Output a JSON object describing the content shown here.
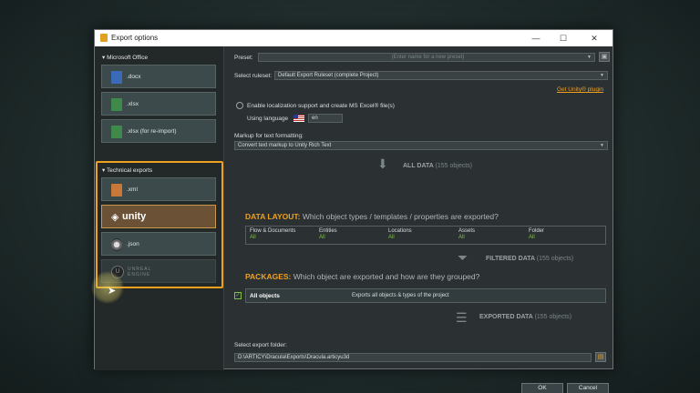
{
  "window": {
    "title": "Export options",
    "controls": {
      "minimize": "—",
      "maximize": "☐",
      "close": "✕"
    }
  },
  "left": {
    "microsoft_office_label": "▾ Microsoft Office",
    "technical_exports_label": "▾ Technical exports",
    "tiles": {
      "docx": ".docx",
      "xlsx": ".xlsx",
      "xlsx_reimport": ".xlsx (for re-import)",
      "xml": ".xml",
      "unity": "unity",
      "json": ".json",
      "unreal": "UNREAL\nENGINE"
    }
  },
  "preset": {
    "label": "Preset:",
    "placeholder": "(Enter name for a new preset)"
  },
  "ruleset": {
    "label": "Select ruleset:",
    "value": "Default Export Ruleset (complete Project)"
  },
  "get_unity_plugin": "Get Unity® plugin",
  "localization": {
    "checkbox_label": "Enable localization support and create MS Excel® file(s)",
    "using_language_label": "Using language",
    "language_value": "en"
  },
  "markup": {
    "label": "Markup for text formatting:",
    "value": "Convert text markup to Unity Rich Text"
  },
  "all_data": {
    "title": "ALL DATA",
    "count": "(155 objects)"
  },
  "data_layout": {
    "highlight": "DATA LAYOUT:",
    "question": "Which object types / templates / properties are exported?",
    "columns": [
      {
        "name": "Flow & Documents",
        "value": "All"
      },
      {
        "name": "Entities",
        "value": "All"
      },
      {
        "name": "Locations",
        "value": "All"
      },
      {
        "name": "Assets",
        "value": "All"
      },
      {
        "name": "Folder",
        "value": "All"
      }
    ]
  },
  "filtered_data": {
    "title": "FILTERED DATA",
    "count": "(155 objects)"
  },
  "packages": {
    "highlight": "PACKAGES:",
    "question": "Which object are exported and how are they grouped?",
    "row_name": "All objects",
    "row_desc": "Exports all objects & types of the project"
  },
  "exported_data": {
    "title": "EXPORTED DATA",
    "count": "(155 objects)"
  },
  "export_folder": {
    "label": "Select export folder:",
    "value": "D:\\ARTICY\\Dracula\\Exports\\Dracula.articyu3d"
  },
  "buttons": {
    "ok": "OK",
    "cancel": "Cancel"
  },
  "colors": {
    "accent": "#f0a020",
    "value_green": "#7fbf4a",
    "unity_tile": "#6b5236"
  }
}
